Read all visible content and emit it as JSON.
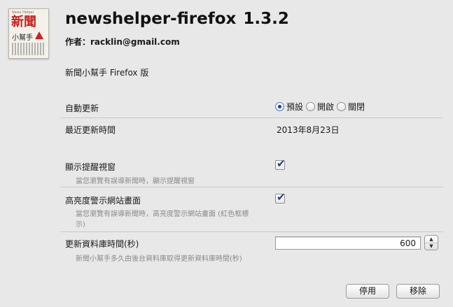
{
  "addon": {
    "name": "newshelper-firefox",
    "version": "1.3.2",
    "author": "作者：racklin@gmail.com",
    "description": "新聞小幫手 Firefox 版",
    "logo": {
      "tiny_text": "News Helper",
      "big_text": "新聞",
      "small_text": "小幫手"
    }
  },
  "settings": {
    "auto_update": {
      "label": "自動更新",
      "options": [
        "預設",
        "開啟",
        "關閉"
      ],
      "selected": "預設"
    },
    "last_update": {
      "label": "最近更新時間",
      "value": "2013年8月23日"
    },
    "show_notification": {
      "label": "顯示提醒視窗",
      "sub": "當您瀏覽有誤導新聞時，顯示提醒視窗",
      "checked": true
    },
    "highlight_warning": {
      "label": "高亮度警示網站畫面",
      "sub_line1": "當您瀏覽有誤導新聞時，高亮度警示網站畫面 (紅色框標",
      "sub_line2": "示)",
      "checked": true
    },
    "db_update_interval": {
      "label": "更新資料庫時間(秒)",
      "value": "600",
      "sub": "新聞小幫手多久由後台資料庫取得更新資料庫時間(秒)"
    }
  },
  "buttons": {
    "disable": "停用",
    "remove": "移除"
  },
  "icons": {
    "checkmark": "✔",
    "up": "▲",
    "down": "▼"
  }
}
